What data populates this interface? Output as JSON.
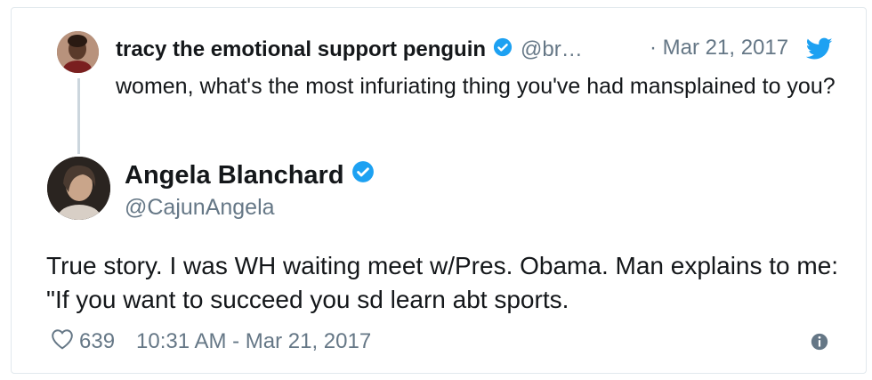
{
  "quoted": {
    "name": "tracy the emotional support penguin",
    "handle": "@br…",
    "date": "· Mar 21, 2017",
    "text": "women, what's the most infuriating thing you've had mansplained to you?"
  },
  "tweet": {
    "name": "Angela Blanchard",
    "handle": "@CajunAngela",
    "text": "True story. I was WH waiting meet w/Pres.  Obama. Man explains to me: \"If you want to succeed you sd learn abt sports.",
    "likes": "639",
    "timestamp": "10:31 AM - Mar 21, 2017"
  },
  "icons": {
    "verified": "verified-badge-icon",
    "bird": "twitter-bird-icon",
    "heart": "heart-icon",
    "info": "info-icon"
  },
  "colors": {
    "brand_blue": "#1da1f2",
    "secondary_text": "#657786",
    "thread_line": "#ccd6dd"
  }
}
